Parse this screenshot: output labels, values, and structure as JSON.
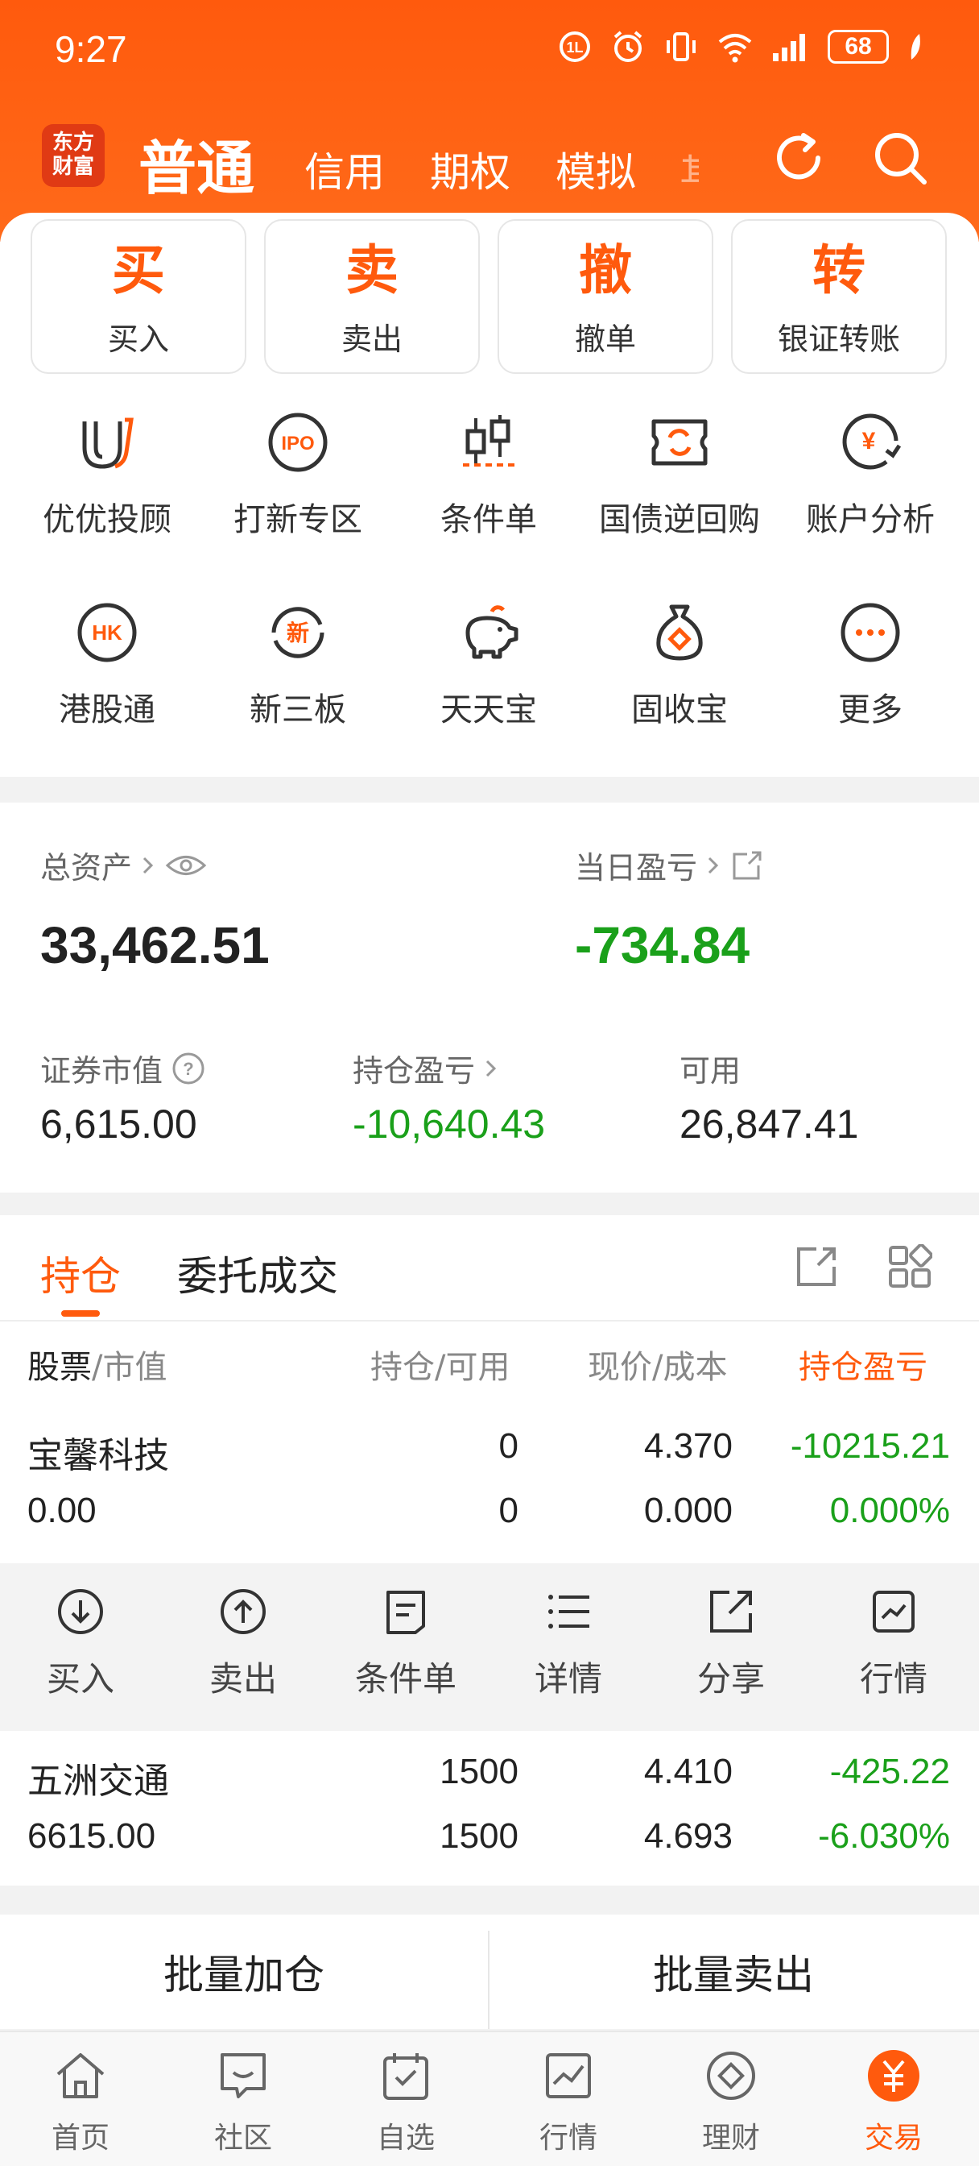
{
  "status_bar": {
    "time": "9:27",
    "battery": "68"
  },
  "header": {
    "logo_line1": "东方",
    "logo_line2": "财富",
    "tabs": [
      {
        "label": "普通",
        "active": true
      },
      {
        "label": "信用"
      },
      {
        "label": "期权"
      },
      {
        "label": "模拟"
      },
      {
        "label": "其"
      }
    ]
  },
  "actions": [
    {
      "big": "买",
      "small": "买入"
    },
    {
      "big": "卖",
      "small": "卖出"
    },
    {
      "big": "撤",
      "small": "撤单"
    },
    {
      "big": "转",
      "small": "银证转账"
    }
  ],
  "grid": [
    {
      "label": "优优投顾",
      "icon": "uu-icon"
    },
    {
      "label": "打新专区",
      "icon": "ipo-icon",
      "text": "IPO"
    },
    {
      "label": "条件单",
      "icon": "candlestick-icon"
    },
    {
      "label": "国债逆回购",
      "icon": "repo-ticket-icon"
    },
    {
      "label": "账户分析",
      "icon": "yuan-chart-icon",
      "text": "¥"
    },
    {
      "label": "港股通",
      "icon": "hk-icon",
      "text": "HK"
    },
    {
      "label": "新三板",
      "icon": "new-board-icon",
      "text": "新"
    },
    {
      "label": "天天宝",
      "icon": "piggy-bank-icon"
    },
    {
      "label": "固收宝",
      "icon": "money-bag-icon"
    },
    {
      "label": "更多",
      "icon": "more-icon"
    }
  ],
  "assets": {
    "total_label": "总资产",
    "total_value": "33,462.51",
    "daily_label": "当日盈亏",
    "daily_value": "-734.84",
    "market_label": "证券市值",
    "market_value": "6,615.00",
    "hold_pl_label": "持仓盈亏",
    "hold_pl_value": "-10,640.43",
    "available_label": "可用",
    "available_value": "26,847.41"
  },
  "positions": {
    "tabs": [
      "持仓",
      "委托成交"
    ],
    "columns": {
      "stock": "股票",
      "market": "/市值",
      "hold": "持仓/可用",
      "price": "现价/成本",
      "pl": "持仓盈亏"
    },
    "rows": [
      {
        "name": "宝馨科技",
        "market_value": "0.00",
        "hold": "0",
        "available": "0",
        "price": "4.370",
        "cost": "0.000",
        "pl": "-10215.21",
        "pl_pct": "0.000%"
      },
      {
        "name": "五洲交通",
        "market_value": "6615.00",
        "hold": "1500",
        "available": "1500",
        "price": "4.410",
        "cost": "4.693",
        "pl": "-425.22",
        "pl_pct": "-6.030%"
      }
    ],
    "row_actions": [
      "买入",
      "卖出",
      "条件单",
      "详情",
      "分享",
      "行情"
    ]
  },
  "batch": {
    "add": "批量加仓",
    "sell": "批量卖出"
  },
  "bottom_nav": [
    {
      "label": "首页",
      "icon": "home-icon"
    },
    {
      "label": "社区",
      "icon": "community-icon"
    },
    {
      "label": "自选",
      "icon": "watchlist-icon"
    },
    {
      "label": "行情",
      "icon": "market-icon"
    },
    {
      "label": "理财",
      "icon": "wealth-icon"
    },
    {
      "label": "交易",
      "icon": "trade-icon",
      "active": true
    }
  ],
  "colors": {
    "brand": "#ff5a0d",
    "loss_green": "#1aa01a"
  }
}
